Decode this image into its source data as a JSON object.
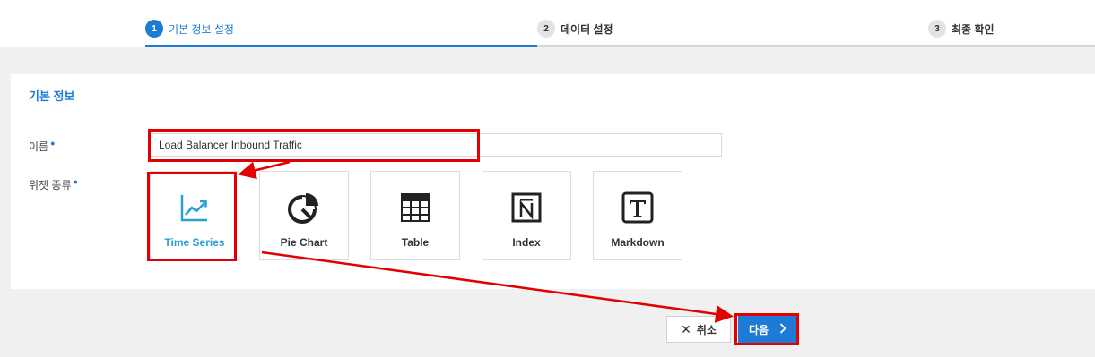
{
  "steps": [
    {
      "num": "1",
      "label": "기본 정보 설정",
      "active": true
    },
    {
      "num": "2",
      "label": "데이터 설정",
      "active": false
    },
    {
      "num": "3",
      "label": "최종 확인",
      "active": false
    }
  ],
  "panel": {
    "title": "기본 정보"
  },
  "form": {
    "name_label": "이름",
    "name_value": "Load Balancer Inbound Traffic",
    "widget_type_label": "위젯 종류",
    "required_mark": "●"
  },
  "widget_types": [
    {
      "label": "Time Series",
      "icon": "line-chart-icon",
      "selected": true
    },
    {
      "label": "Pie Chart",
      "icon": "pie-chart-icon",
      "selected": false
    },
    {
      "label": "Table",
      "icon": "table-icon",
      "selected": false
    },
    {
      "label": "Index",
      "icon": "index-icon",
      "selected": false
    },
    {
      "label": "Markdown",
      "icon": "markdown-icon",
      "selected": false
    }
  ],
  "buttons": {
    "cancel_label": "취소",
    "next_label": "다음"
  },
  "colors": {
    "accent": "#1d7bd6",
    "selected_text": "#2a9fd6",
    "annotation": "#e30000"
  }
}
